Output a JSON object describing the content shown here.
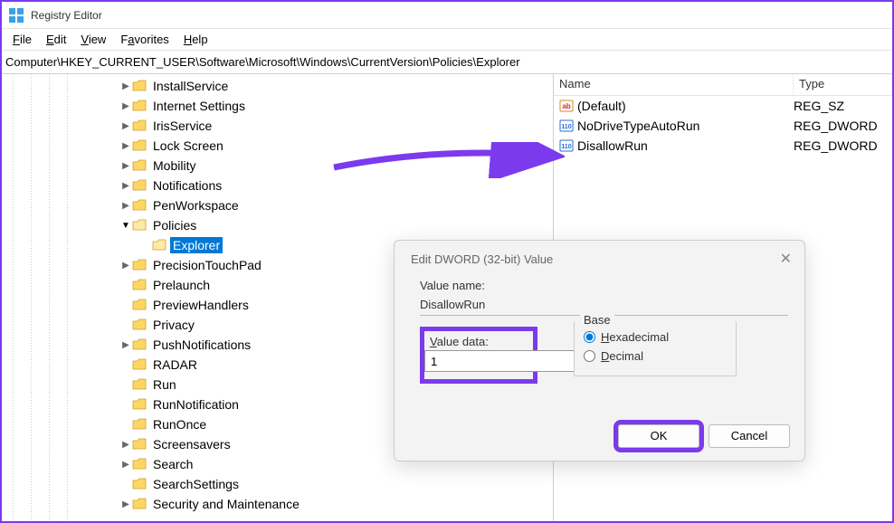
{
  "app": {
    "title": "Registry Editor"
  },
  "menu": {
    "file": "File",
    "edit": "Edit",
    "view": "View",
    "favorites": "Favorites",
    "help": "Help"
  },
  "address": "Computer\\HKEY_CURRENT_USER\\Software\\Microsoft\\Windows\\CurrentVersion\\Policies\\Explorer",
  "tree": [
    {
      "label": "InstallService",
      "caret": "▶",
      "indent": 130
    },
    {
      "label": "Internet Settings",
      "caret": "▶",
      "indent": 130
    },
    {
      "label": "IrisService",
      "caret": "▶",
      "indent": 130
    },
    {
      "label": "Lock Screen",
      "caret": "▶",
      "indent": 130
    },
    {
      "label": "Mobility",
      "caret": "▶",
      "indent": 130
    },
    {
      "label": "Notifications",
      "caret": "▶",
      "indent": 130
    },
    {
      "label": "PenWorkspace",
      "caret": "▶",
      "indent": 130
    },
    {
      "label": "Policies",
      "caret": "▼",
      "indent": 130,
      "open": true
    },
    {
      "label": "Explorer",
      "caret": "",
      "indent": 152,
      "selected": true
    },
    {
      "label": "PrecisionTouchPad",
      "caret": "▶",
      "indent": 130
    },
    {
      "label": "Prelaunch",
      "caret": "",
      "indent": 130
    },
    {
      "label": "PreviewHandlers",
      "caret": "",
      "indent": 130
    },
    {
      "label": "Privacy",
      "caret": "",
      "indent": 130
    },
    {
      "label": "PushNotifications",
      "caret": "▶",
      "indent": 130
    },
    {
      "label": "RADAR",
      "caret": "",
      "indent": 130
    },
    {
      "label": "Run",
      "caret": "",
      "indent": 130
    },
    {
      "label": "RunNotification",
      "caret": "",
      "indent": 130
    },
    {
      "label": "RunOnce",
      "caret": "",
      "indent": 130
    },
    {
      "label": "Screensavers",
      "caret": "▶",
      "indent": 130
    },
    {
      "label": "Search",
      "caret": "▶",
      "indent": 130
    },
    {
      "label": "SearchSettings",
      "caret": "",
      "indent": 130
    },
    {
      "label": "Security and Maintenance",
      "caret": "▶",
      "indent": 130
    }
  ],
  "list": {
    "cols": {
      "name": "Name",
      "type": "Type"
    },
    "rows": [
      {
        "name": "(Default)",
        "type": "REG_SZ",
        "kind": "str"
      },
      {
        "name": "NoDriveTypeAutoRun",
        "type": "REG_DWORD",
        "kind": "bin"
      },
      {
        "name": "DisallowRun",
        "type": "REG_DWORD",
        "kind": "bin"
      }
    ]
  },
  "dialog": {
    "title": "Edit DWORD (32-bit) Value",
    "valueNameLabel": "Value name:",
    "valueName": "DisallowRun",
    "valueDataLabel": "Value data:",
    "valueData": "1",
    "baseLabel": "Base",
    "hex": "Hexadecimal",
    "dec": "Decimal",
    "ok": "OK",
    "cancel": "Cancel"
  }
}
